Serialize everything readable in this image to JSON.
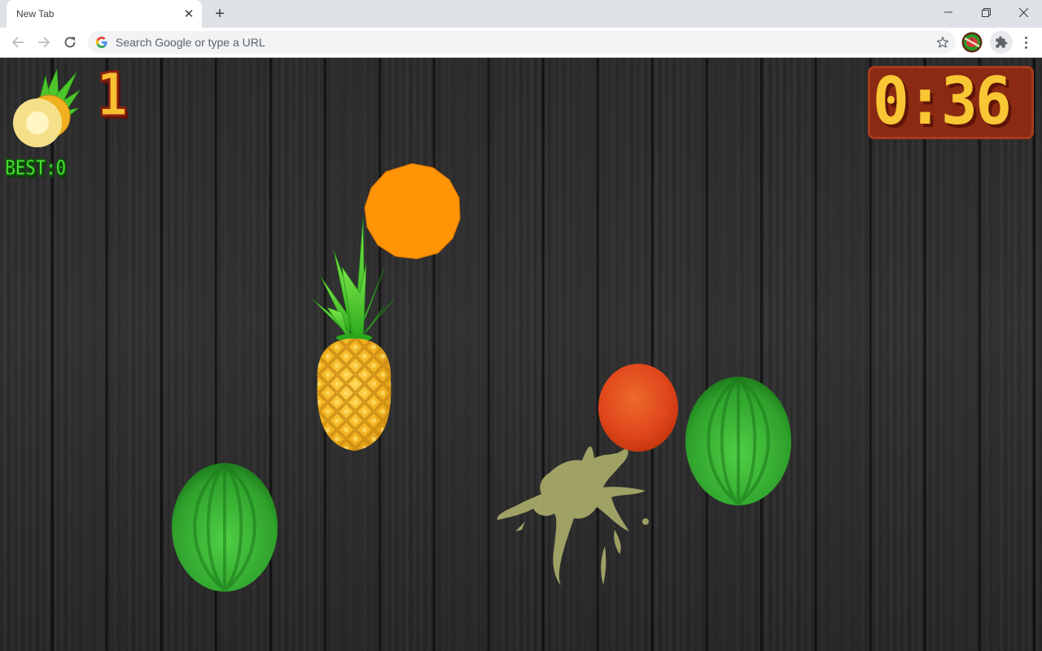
{
  "browser": {
    "tab": {
      "title": "New Tab",
      "close_glyph": "✕"
    },
    "new_tab_glyph": "+",
    "window": {
      "minimize_icon": "minimize-icon",
      "restore_icon": "restore-icon",
      "close_icon": "close-icon"
    },
    "nav": {
      "back_icon": "arrow-left-icon",
      "forward_icon": "arrow-right-icon",
      "reload_icon": "reload-icon"
    },
    "omnibox": {
      "placeholder": "Search Google or type a URL",
      "value": ""
    },
    "extensions": [
      {
        "name": "fruit-slicer-extension",
        "icon": "watermelon-slash-icon"
      },
      {
        "name": "extensions-menu",
        "icon": "puzzle-icon"
      }
    ],
    "colors": {
      "titlebar": "#dee1e6",
      "toolbar": "#ffffff",
      "omnibox": "#f1f3f4"
    }
  },
  "game": {
    "hud": {
      "score_icon": "sliced-pineapple-icon",
      "score": "1",
      "best_label": "BEST:",
      "best_value": "0",
      "timer": "0:36"
    },
    "objects": [
      {
        "type": "orange",
        "state": "whole",
        "color": "#ff9407"
      },
      {
        "type": "pineapple",
        "state": "whole",
        "color": "#f2b21d"
      },
      {
        "type": "watermelon",
        "state": "whole",
        "color": "#2fa12c"
      },
      {
        "type": "tomato",
        "state": "whole",
        "color": "#e0461c"
      },
      {
        "type": "watermelon",
        "state": "whole",
        "color": "#2fa12c"
      },
      {
        "type": "juice-splat",
        "state": "splatter",
        "color": "#a9ab6a"
      }
    ],
    "colors": {
      "score_fill": "#f7c030",
      "score_outline": "#8a1f10",
      "best_fill": "#4fe23a",
      "timer_fill": "#f9c733",
      "timer_box": "#8b2a12",
      "background": "#2b2b2b"
    }
  }
}
